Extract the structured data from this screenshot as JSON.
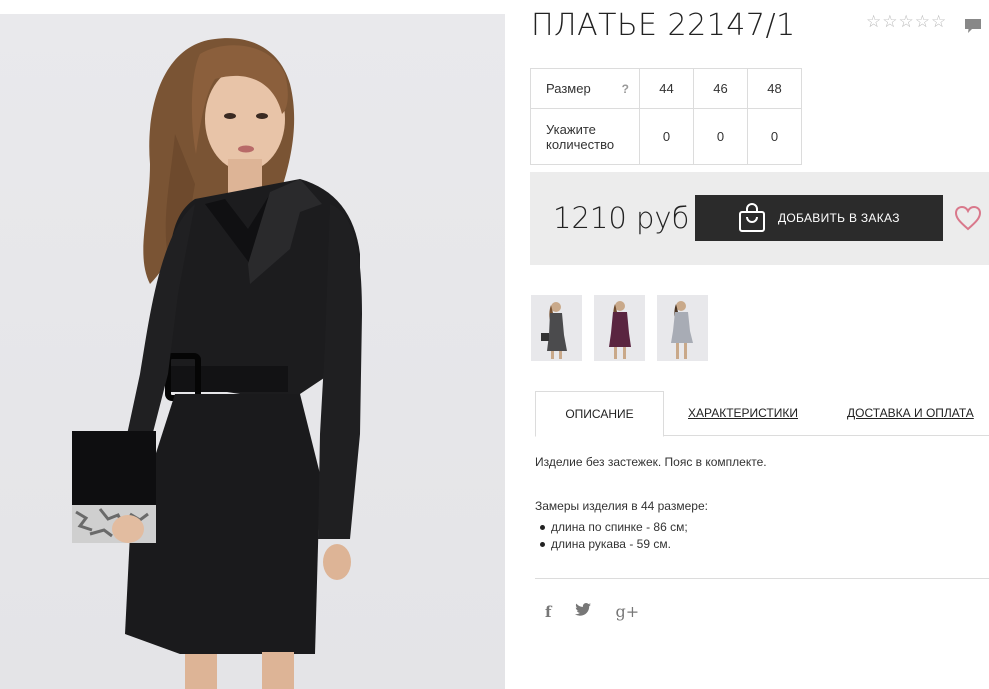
{
  "product": {
    "title": "ПЛАТЬЕ 22147/1",
    "rating_stars": 5
  },
  "size_table": {
    "size_label": "Размер",
    "help": "?",
    "sizes": [
      "44",
      "46",
      "48"
    ],
    "qty_label_line1": "Укажите",
    "qty_label_line2": "количество",
    "quantities": [
      "0",
      "0",
      "0"
    ]
  },
  "purchase": {
    "price": "1210 руб",
    "add_button": "ДОБАВИТЬ В ЗАКАЗ"
  },
  "tabs": [
    {
      "label": "ОПИСАНИЕ",
      "active": true
    },
    {
      "label": "ХАРАКТЕРИСТИКИ",
      "active": false
    },
    {
      "label": "ДОСТАВКА И ОПЛАТА",
      "active": false
    }
  ],
  "description": {
    "text": "Изделие без застежек. Пояс в комплекте.",
    "measures_title": "Замеры изделия в 44 размере:",
    "measures": [
      "длина по спинке - 86 см;",
      "длина рукава - 59 см."
    ]
  },
  "social": {
    "facebook": "f",
    "twitter": "t",
    "googleplus": "g+"
  },
  "colors": {
    "button_bg": "#2b2b2b",
    "panel_bg": "#ececec",
    "heart": "#d9788b",
    "thumb2_dress": "#5a2540",
    "thumb3_dress": "#a8acb5"
  },
  "icons": [
    "star-icon",
    "comment-icon",
    "shopping-bag-icon",
    "heart-icon",
    "facebook-icon",
    "twitter-icon",
    "google-plus-icon"
  ]
}
